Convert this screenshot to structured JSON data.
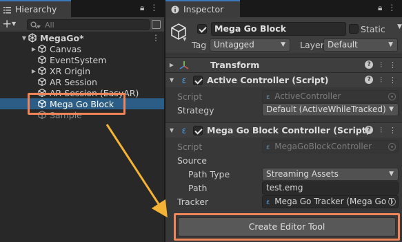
{
  "hierarchy": {
    "tab_label": "Hierarchy",
    "search_placeholder": "All",
    "scene": "MegaGo*",
    "items": [
      {
        "label": "Canvas",
        "expandable": true,
        "disabled": false,
        "selected": false
      },
      {
        "label": "EventSystem",
        "expandable": false,
        "disabled": false,
        "selected": false
      },
      {
        "label": "XR Origin",
        "expandable": true,
        "disabled": false,
        "selected": false
      },
      {
        "label": "AR Session",
        "expandable": false,
        "disabled": false,
        "selected": false
      },
      {
        "label": "AR Session (EasyAR)",
        "expandable": false,
        "disabled": false,
        "selected": false
      },
      {
        "label": "Mega Go Block",
        "expandable": false,
        "disabled": false,
        "selected": true
      },
      {
        "label": "Sample",
        "expandable": false,
        "disabled": true,
        "selected": false
      }
    ]
  },
  "inspector": {
    "tab_label": "Inspector",
    "object_name": "Mega Go Block",
    "static_label": "Static",
    "tag_label": "Tag",
    "tag_value": "Untagged",
    "layer_label": "Layer",
    "layer_value": "Default",
    "components": {
      "transform": {
        "title": "Transform"
      },
      "active_controller": {
        "title": "Active Controller (Script)",
        "script_label": "Script",
        "script_value": "ActiveController",
        "strategy_label": "Strategy",
        "strategy_value": "Default (ActiveWhileTracked)"
      },
      "mega_go_block_controller": {
        "title": "Mega Go Block Controller (Script)",
        "script_label": "Script",
        "script_value": "MegaGoBlockController",
        "source_label": "Source",
        "path_type_label": "Path Type",
        "path_type_value": "Streaming Assets",
        "path_label": "Path",
        "path_value": "test.emg",
        "tracker_label": "Tracker",
        "tracker_value": "Mega Go Tracker (Mega Go T"
      }
    },
    "create_button": "Create Editor Tool"
  },
  "colors": {
    "selection": "#2c5d87",
    "annotation": "#f0855a",
    "arrow": "#f5b335"
  }
}
